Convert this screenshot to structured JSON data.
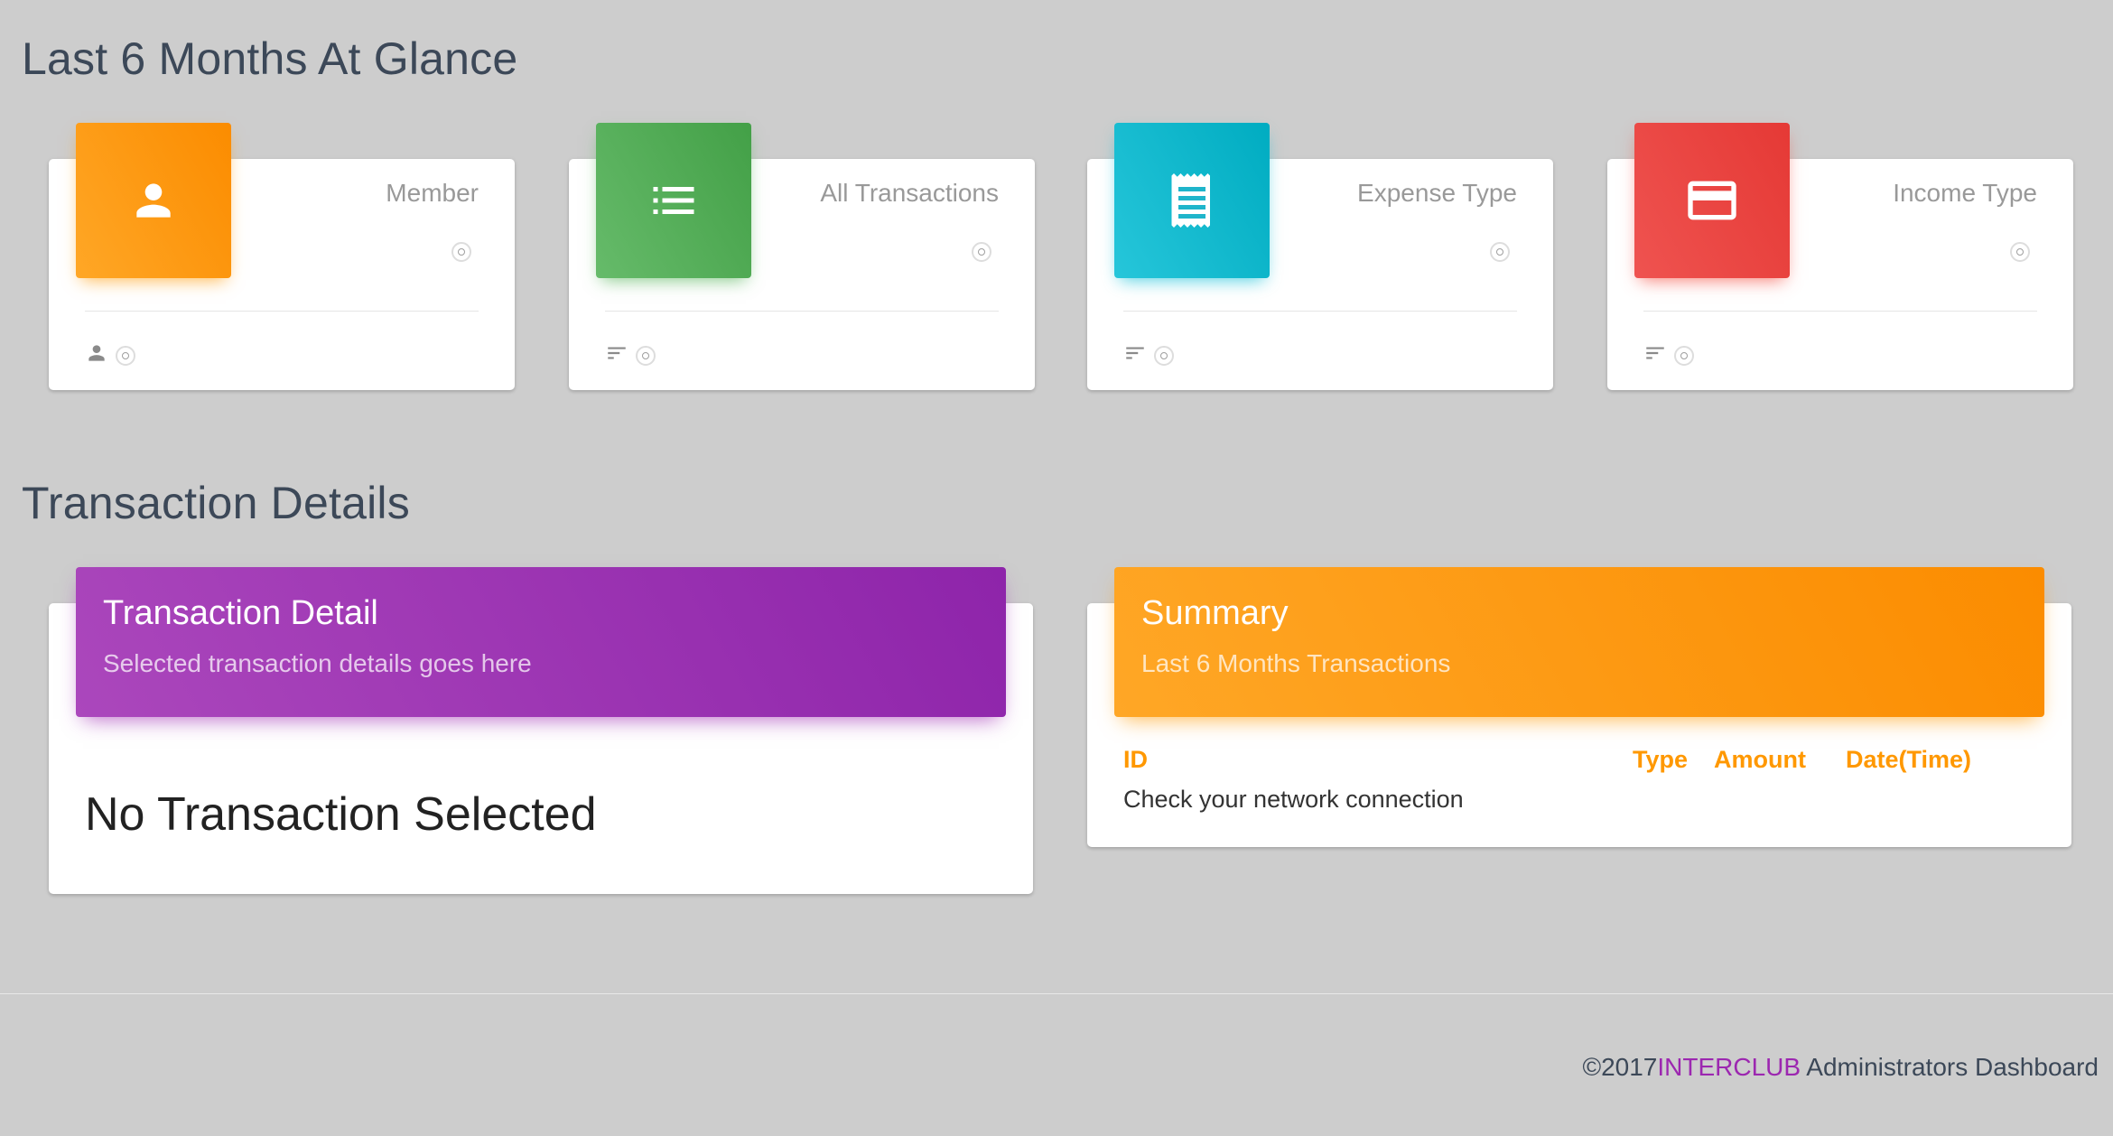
{
  "sections": {
    "overview_title": "Last 6 Months At Glance",
    "details_title": "Transaction Details"
  },
  "stats": [
    {
      "label": "Member",
      "icon": "person-icon",
      "footer_icon": "person-small-icon",
      "color": "#fb8c00"
    },
    {
      "label": "All Transactions",
      "icon": "list-icon",
      "footer_icon": "sort-icon",
      "color": "#43a047"
    },
    {
      "label": "Expense Type",
      "icon": "receipt-icon",
      "footer_icon": "sort-icon",
      "color": "#00acc1"
    },
    {
      "label": "Income Type",
      "icon": "credit-card-icon",
      "footer_icon": "sort-icon",
      "color": "#e53935"
    }
  ],
  "detail_card": {
    "title": "Transaction Detail",
    "subtitle": "Selected transaction details goes here",
    "empty_text": "No Transaction Selected",
    "color": "#8e24aa"
  },
  "summary_card": {
    "title": "Summary",
    "subtitle": "Last 6 Months Transactions",
    "columns": [
      "ID",
      "Type",
      "Amount",
      "Date(Time)"
    ],
    "message": "Check your network connection",
    "color": "#fb8c00"
  },
  "footer": {
    "copyright": "©2017",
    "brand": "INTERCLUB",
    "suffix": " Administrators Dashboard",
    "brand_color": "#9c27b0"
  }
}
